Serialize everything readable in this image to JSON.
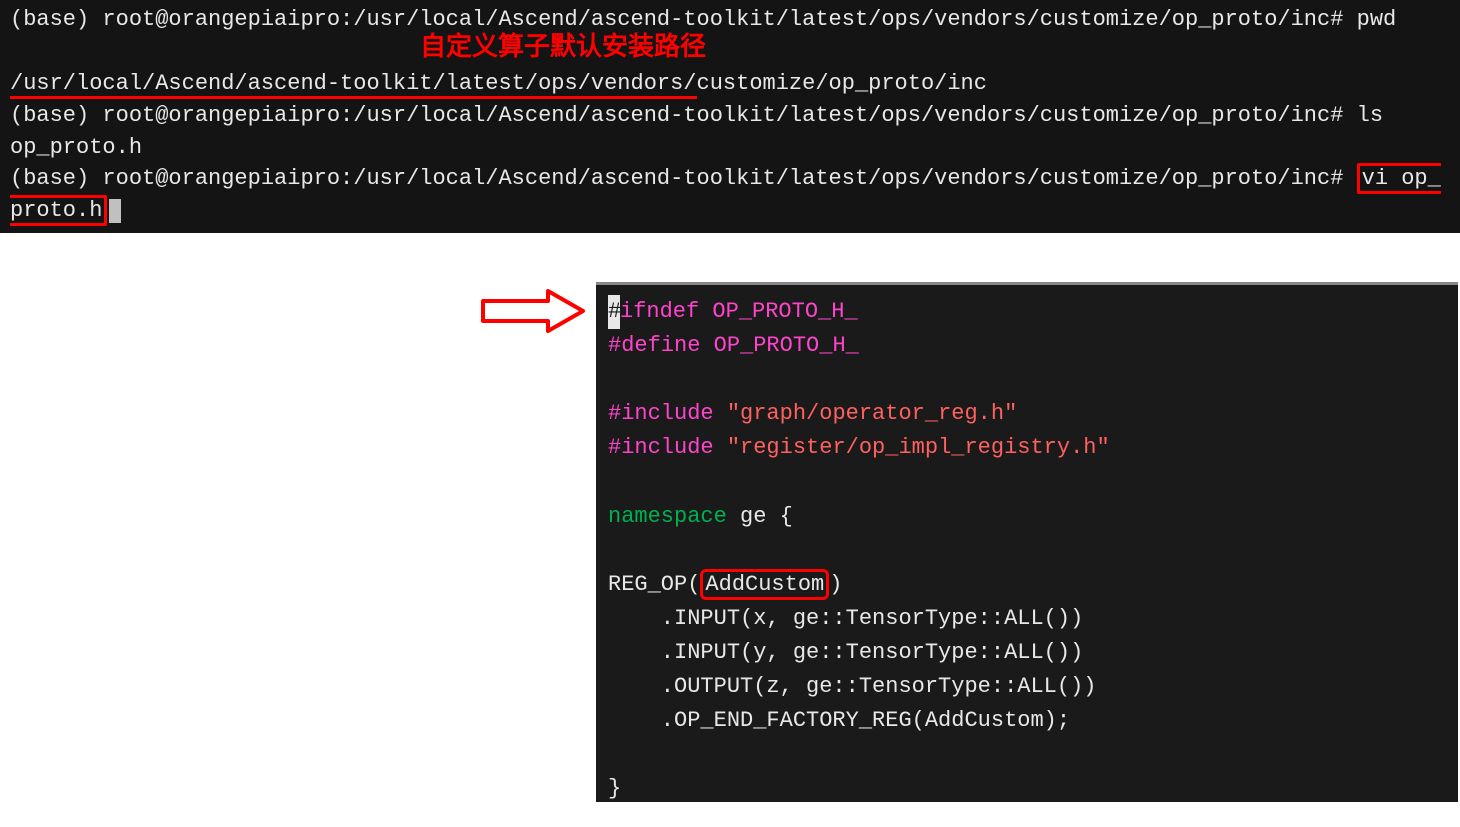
{
  "terminal": {
    "prompt1": "(base) root@orangepiaipro:/usr/local/Ascend/ascend-toolkit/latest/ops/vendors/customize/op_proto/inc# ",
    "cmd1": "pwd",
    "annotation": "自定义算子默认安装路径",
    "path_underlined": "/usr/local/Ascend/ascend-toolkit/latest/ops/vendors/",
    "path_rest": "customize/op_proto/inc",
    "prompt2": "(base) root@orangepiaipro:/usr/local/Ascend/ascend-toolkit/latest/ops/vendors/customize/op_proto/inc# ",
    "cmd2": "ls",
    "ls_output": "op_proto.h",
    "prompt3": "(base) root@orangepiaipro:/usr/local/Ascend/ascend-toolkit/latest/ops/vendors/customize/op_proto/inc# ",
    "cmd3_boxed": "vi op_proto.h"
  },
  "editor": {
    "l1_hash": "#",
    "l1_rest": "ifndef",
    "l1_sym": " OP_PROTO_H_",
    "l2": "#define",
    "l2_sym": " OP_PROTO_H_",
    "l3": "",
    "l4_inc": "#include ",
    "l4_str": "\"graph/operator_reg.h\"",
    "l5_inc": "#include ",
    "l5_str": "\"register/op_impl_registry.h\"",
    "l6": "",
    "l7_ns": "namespace",
    "l7_rest": " ge {",
    "l8": "",
    "l9_pre": "REG_OP(",
    "l9_op": "AddCustom",
    "l9_post": ")",
    "l10": "    .INPUT(x, ge::TensorType::ALL())",
    "l11": "    .INPUT(y, ge::TensorType::ALL())",
    "l12": "    .OUTPUT(z, ge::TensorType::ALL())",
    "l13": "    .OP_END_FACTORY_REG(AddCustom);",
    "l14": "",
    "l15": "}"
  },
  "icons": {
    "arrow": "arrow-right"
  }
}
